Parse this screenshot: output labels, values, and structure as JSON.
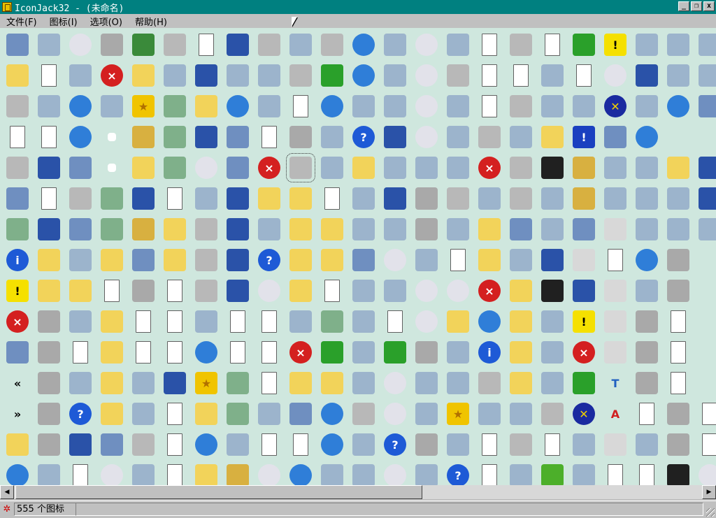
{
  "window": {
    "title": "IconJack32 - (未命名)",
    "minimize_label": "_",
    "restore_label": "❐",
    "close_label": "x"
  },
  "menu": [
    {
      "label": "文件(F)"
    },
    {
      "label": "图标(I)"
    },
    {
      "label": "选项(O)"
    },
    {
      "label": "帮助(H)"
    }
  ],
  "status": {
    "icon": "red-asterisk-icon",
    "count_text": "555 个图标"
  },
  "scrollbar": {
    "left_arrow": "◀",
    "right_arrow": "▶"
  },
  "icon_grid": {
    "columns": 23,
    "selected_index": 101,
    "rows": [
      [
        "computer",
        "envelope",
        "cd-drive",
        "network-drive",
        "tree",
        "printer",
        "letter-a-doc",
        "window-gear",
        "fax",
        "mouse",
        "printer",
        "globe-clock",
        "pie-chart",
        "cd-r",
        "mobile-phone",
        "key-doc",
        "printer-stack",
        "media-doc",
        "green-diamond",
        "warning",
        "calendar-grid",
        "toolbox",
        "speaker"
      ],
      [
        "folder-search",
        "word-doc",
        "chip",
        "power-button",
        "folder-computer",
        "floppy-printer",
        "window-card",
        "picture-frame",
        "network-check",
        "scanner",
        "play",
        "globe-sphere",
        "network-globe",
        "cd-rw",
        "printer-color",
        "calendar",
        "checklist",
        "network-computers",
        "edit-doc",
        "dvd",
        "window-grid",
        "toolbox",
        "speaker"
      ],
      [
        "printer-fax",
        "tower",
        "internet-explorer",
        "handshake",
        "star",
        "recycle-bin",
        "folder-error",
        "globe-window",
        "network-check",
        "arrow-doc",
        "globe",
        "puzzle",
        "music-note",
        "dvd-ram",
        "small-drive",
        "settings-doc",
        "printer-gray",
        "network-monitor",
        "red-button",
        "cross-circle",
        "server",
        "globe-arrow",
        "monitor"
      ],
      [
        "blue-arrow-doc",
        "notepad",
        "globe-mouse",
        "shortcut",
        "key-button",
        "recycle-full",
        "window-settings",
        "monitor-window",
        "scanner-doc",
        "drive-selected",
        "camera",
        "help",
        "window-sun",
        "dvd-r",
        "blue-drive",
        "printer-arrow",
        "print-receipt",
        "folder-window",
        "warning-blue",
        "laptop",
        "globe-monitor"
      ],
      [
        "printer-help",
        "window-doc",
        "computers",
        "shortcut-small",
        "folder-search",
        "recycle-bin",
        "cd-rainbow",
        "monitor-blue",
        "no-entry",
        "printer-error",
        "projector",
        "folder-green",
        "users",
        "phone-old",
        "handheld",
        "power-red",
        "printer-network",
        "terminal",
        "padlock",
        "network-computers",
        "teddy-bear",
        "folder",
        "window-clock"
      ],
      [
        "computer-bar",
        "pen-doc",
        "printer",
        "recycle-bin",
        "windows-logo",
        "doc-arrows",
        "color-blocks",
        "window-list",
        "folder-check",
        "folder-open",
        "arrow-doc",
        "mail-open",
        "window-search",
        "drive-gray",
        "scanner",
        "checkbox",
        "fax-printer",
        "book-red",
        "padlock-open",
        "hourglass",
        "java-logo",
        "shield-key",
        "window-search"
      ],
      [
        "recycle-green",
        "window-blank",
        "computers",
        "recycle-green",
        "padlock",
        "folder-arrow",
        "printer-check",
        "window-list",
        "user-key",
        "folder-globe",
        "folder-picture",
        "clock-arrow",
        "comment",
        "drive-gray",
        "camera",
        "folder-eject",
        "monitor-doc",
        "command-key",
        "monitor-screen",
        "resize-box",
        "network-card",
        "warning-drive",
        "disc"
      ],
      [
        "info",
        "folder",
        "network-tree",
        "folder-doc",
        "monitor-window",
        "folder-pen",
        "printer-check",
        "window-list",
        "power-blue",
        "folder-page",
        "folder-computer",
        "monitor-keyboard",
        "cd",
        "camcorder",
        "magnifier-doc",
        "folder-error",
        "network-computers",
        "window-frame",
        "resize-box",
        "pen-doc",
        "globe-no",
        "drive-window"
      ],
      [
        "warning",
        "folder",
        "folder-grid",
        "arrow-doc",
        "drive-error",
        "gear-doc",
        "printer-doc",
        "window-screen",
        "dvd",
        "folder-open",
        "checklist",
        "accessibility",
        "shortcut-box",
        "cd-r",
        "dvd-rw",
        "no-entry",
        "folder-doc",
        "ime-window",
        "windows-stack",
        "resize-box",
        "device",
        "drive-window"
      ],
      [
        "error",
        "drive-gray",
        "clock",
        "folder-tool",
        "copies",
        "gear-doc",
        "org-chart",
        "cursor-doc",
        "pages",
        "msn-butterfly",
        "recycle-bin",
        "users",
        "question-doc",
        "dvd-rom",
        "folder-open",
        "internet-explorer",
        "folder-doc",
        "flag-network",
        "exclamation",
        "resize-box",
        "drive-window",
        "doc"
      ],
      [
        "computer-gray",
        "floppy",
        "paint-doc",
        "folder-grid",
        "search-doc",
        "notepad",
        "globe-computer",
        "cursor-doc",
        "film-doc",
        "red-x",
        "green-arrow",
        "palette",
        "green-next",
        "drive-gray",
        "clock",
        "info",
        "folder-doc",
        "edit-pen",
        "red-cross",
        "resize-box",
        "drive-window",
        "doc"
      ],
      [
        "chevron-left",
        "drive-gray",
        "magnifier",
        "folder-drive",
        "magnifier-monitor",
        "window-gear",
        "star",
        "recycle-bin",
        "music-doc",
        "folder-arrow",
        "folder-open",
        "disc-stack",
        "cd-dvd",
        "battery",
        "checkbox",
        "printer-check",
        "folder-doc",
        "safe",
        "check-green",
        "font-t",
        "drive-window",
        "doc"
      ],
      [
        "chevron-right",
        "drive-gray",
        "help",
        "folder-pen",
        "checkbox",
        "puzzle-doc",
        "folder-list",
        "recycle-bin",
        "pictures",
        "monitor-window",
        "globe-arrow",
        "printer-gray",
        "cd-music",
        "phone-device",
        "star-small",
        "checkbox",
        "calculator",
        "printer-monitor",
        "cross-circle",
        "font-a",
        "search-doc",
        "drive-window",
        "doc"
      ],
      [
        "folder-open",
        "network-drive",
        "window-card",
        "computer-bar",
        "printer",
        "font-doc",
        "globe-arrow",
        "users-group",
        "picture-doc",
        "copies",
        "globe-network",
        "network-computers",
        "help",
        "floppy-yellow",
        "magnifier",
        "question-doc",
        "printer-color",
        "checkmark-doc",
        "user-support",
        "number-one",
        "gear-disc",
        "drive-window",
        "doc"
      ],
      [
        "globe",
        "network-error",
        "speaker-doc",
        "cd-music",
        "picture-frame",
        "font-t-doc",
        "folder-picture",
        "keys",
        "cd-grid",
        "globe-arrow",
        "home",
        "gear-blue",
        "cd-rom",
        "camera",
        "help",
        "arrow-doc",
        "brush",
        "nvidia",
        "user-card",
        "info-doc",
        "wrench-doc",
        "clapperboard",
        "dvd"
      ]
    ]
  }
}
